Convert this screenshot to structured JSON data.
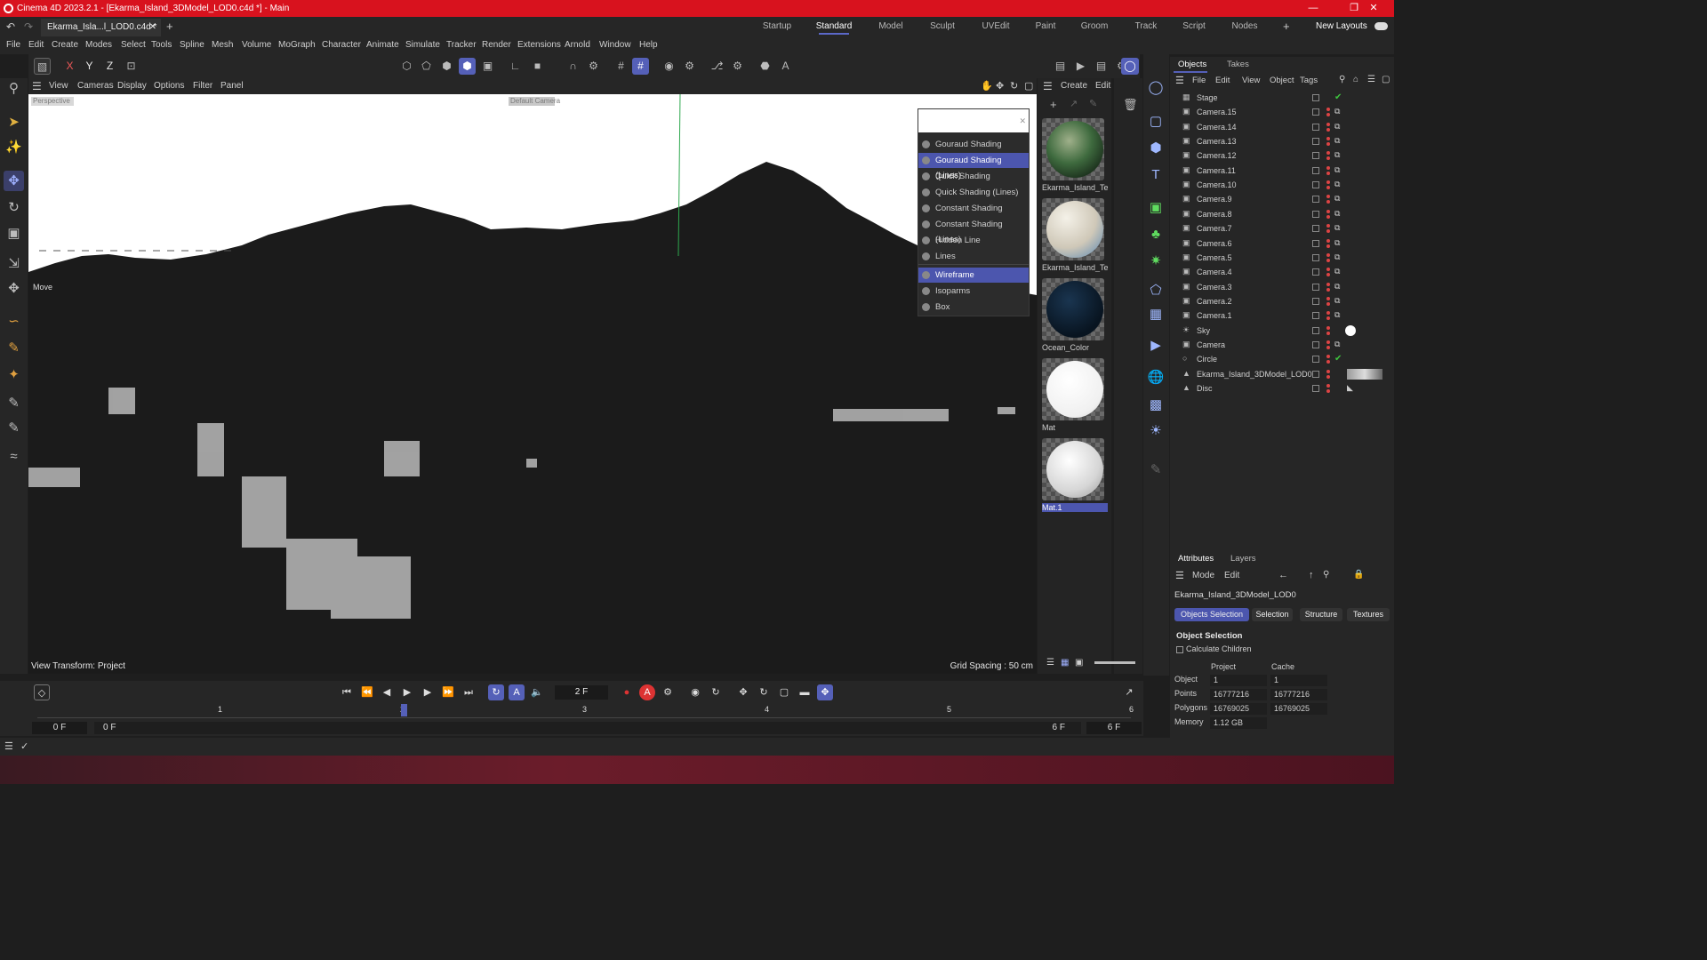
{
  "titlebar": {
    "title": "Cinema 4D 2023.2.1 - [Ekarma_Island_3DModel_LOD0.c4d *] - Main"
  },
  "tabs": {
    "doc_tab": "Ekarma_Isla...l_LOD0.c4d *",
    "layouts": [
      "Startup",
      "Standard",
      "Model",
      "Sculpt",
      "UVEdit",
      "Paint",
      "Groom",
      "Track",
      "Script",
      "Nodes"
    ],
    "active_layout": "Standard",
    "new_layouts": "New Layouts"
  },
  "menu": [
    "File",
    "Edit",
    "Create",
    "Modes",
    "Select",
    "Tools",
    "Spline",
    "Mesh",
    "Volume",
    "MoGraph",
    "Character",
    "Animate",
    "Simulate",
    "Tracker",
    "Render",
    "Extensions",
    "Arnold",
    "Window",
    "Help"
  ],
  "toolbar": {
    "axes": [
      "X",
      "Y",
      "Z"
    ]
  },
  "viewport": {
    "menu": [
      "View",
      "Cameras",
      "Display",
      "Options",
      "Filter",
      "Panel"
    ],
    "camera_label": "Perspective",
    "camera_name": "Default Camera",
    "move_label": "Move",
    "view_transform": "View Transform: Project",
    "grid_spacing": "Grid Spacing : 50 cm"
  },
  "shading_menu": {
    "items": [
      "Gouraud Shading",
      "Gouraud Shading (Lines)",
      "Quick Shading",
      "Quick Shading (Lines)",
      "Constant Shading",
      "Constant Shading (Lines)",
      "Hidden Line",
      "Lines"
    ],
    "items2": [
      "Wireframe",
      "Isoparms",
      "Box"
    ],
    "selected": [
      "Gouraud Shading (Lines)",
      "Wireframe"
    ]
  },
  "materials": {
    "menu": [
      "Create",
      "Edit"
    ],
    "items": [
      {
        "label": "Ekarma_Island_Tex",
        "color": "#4a6b4a"
      },
      {
        "label": "Ekarma_Island_Tex",
        "color": "#d9d4c8"
      },
      {
        "label": "Ocean_Color",
        "color": "#0c1722"
      },
      {
        "label": "Mat",
        "color": "#ffffff"
      },
      {
        "label": "Mat.1",
        "color": "#e6e6e6"
      }
    ],
    "selected": "Mat.1"
  },
  "objects": {
    "tabs": [
      "Objects",
      "Takes"
    ],
    "menu": [
      "File",
      "Edit",
      "View",
      "Object",
      "Tags"
    ],
    "items": [
      "Stage",
      "Camera.15",
      "Camera.14",
      "Camera.13",
      "Camera.12",
      "Camera.11",
      "Camera.10",
      "Camera.9",
      "Camera.8",
      "Camera.7",
      "Camera.6",
      "Camera.5",
      "Camera.4",
      "Camera.3",
      "Camera.2",
      "Camera.1",
      "Sky",
      "Camera",
      "Circle",
      "Ekarma_Island_3DModel_LOD0",
      "Disc"
    ]
  },
  "attributes": {
    "tabs": [
      "Attributes",
      "Layers"
    ],
    "menu": [
      "Mode",
      "Edit"
    ],
    "object_name": "Ekarma_Island_3DModel_LOD0",
    "sub_tabs": [
      "Objects Selection",
      "Selection",
      "Structure",
      "Textures"
    ],
    "section": "Object Selection",
    "checkbox": "Calculate Children",
    "cols": [
      "Project",
      "Cache"
    ],
    "rows": [
      {
        "label": "Object",
        "project": "1",
        "cache": "1"
      },
      {
        "label": "Points",
        "project": "16777216",
        "cache": "16777216"
      },
      {
        "label": "Polygons",
        "project": "16769025",
        "cache": "16769025"
      },
      {
        "label": "Memory",
        "project": "1.12 GB",
        "cache": ""
      }
    ]
  },
  "timeline": {
    "current_frame": "2 F",
    "ruler": [
      "1",
      "2",
      "3",
      "4",
      "5",
      "6"
    ],
    "start": "0 F",
    "start2": "0 F",
    "end": "6 F",
    "end2": "6 F"
  }
}
